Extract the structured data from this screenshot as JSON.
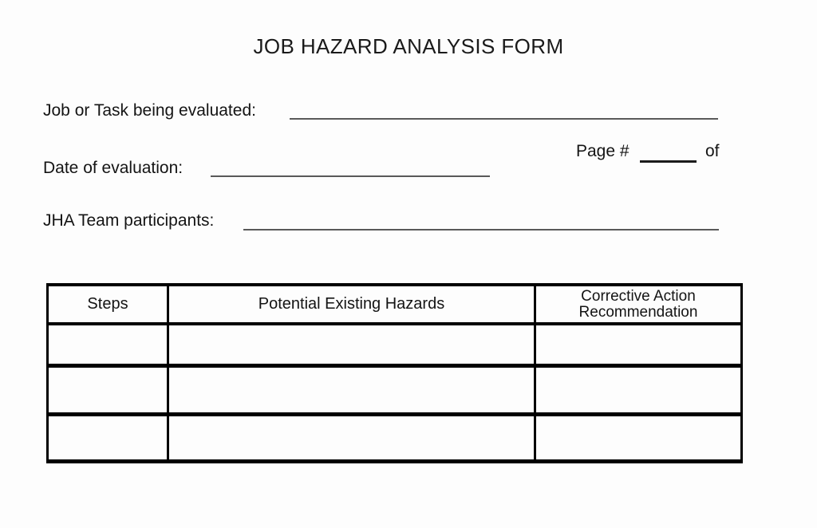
{
  "document": {
    "title": "JOB HAZARD ANALYSIS FORM"
  },
  "fields": {
    "job_task": {
      "label": "Job or Task being evaluated:",
      "value": "",
      "placeholder": ""
    },
    "date_of_evaluation": {
      "label": "Date of evaluation:",
      "value": "",
      "placeholder": ""
    },
    "page_number": {
      "label": "Page #",
      "suffix_label": "of",
      "value": "",
      "total_value": "",
      "placeholder": ""
    },
    "jha_team": {
      "label": "JHA Team participants:",
      "value": "",
      "placeholder": ""
    }
  },
  "table": {
    "headers": [
      "Steps",
      "Potential Existing Hazards",
      "Corrective Action",
      "Recommendation"
    ],
    "header_col3_line1": "Corrective Action",
    "header_col3_line2": "Recommendation",
    "rows": [
      {
        "steps": "",
        "hazards": "",
        "corrective_action": ""
      },
      {
        "steps": "",
        "hazards": "",
        "corrective_action": ""
      },
      {
        "steps": "",
        "hazards": "",
        "corrective_action": ""
      }
    ],
    "row_count": 3
  },
  "colors": {
    "page_background": "#fdfdfd",
    "text": "#141414",
    "field_rule": "#595959",
    "table_border": "#000000"
  }
}
